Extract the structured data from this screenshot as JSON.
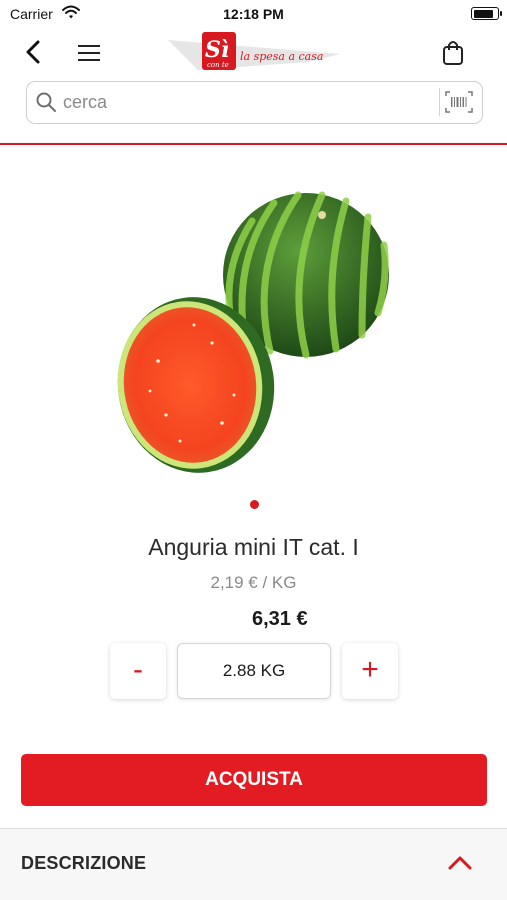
{
  "status_bar": {
    "carrier": "Carrier",
    "time": "12:18 PM",
    "battery_level": 0.9
  },
  "header": {
    "logo_lettering": "Sì con te",
    "logo_tagline": "la spesa a casa",
    "back_icon": "chevron-left-icon",
    "menu_icon": "hamburger-icon",
    "cart_icon": "shopping-bag-icon"
  },
  "search": {
    "placeholder": "cerca",
    "value": "",
    "barcode_icon": "barcode-icon"
  },
  "product": {
    "name": "Anguria mini IT cat. I",
    "unit_price": "2,19 € / KG",
    "total_price": "6,31 €",
    "image_pages": 1,
    "current_page": 1
  },
  "quantity": {
    "decrement_label": "-",
    "value": "2.88 KG",
    "increment_label": "+"
  },
  "buy_button": {
    "label": "ACQUISTA"
  },
  "description": {
    "label": "DESCRIZIONE",
    "expanded": true
  },
  "colors": {
    "accent": "#e31b23",
    "text": "#2b2b2b",
    "muted": "#8a8a8a"
  }
}
